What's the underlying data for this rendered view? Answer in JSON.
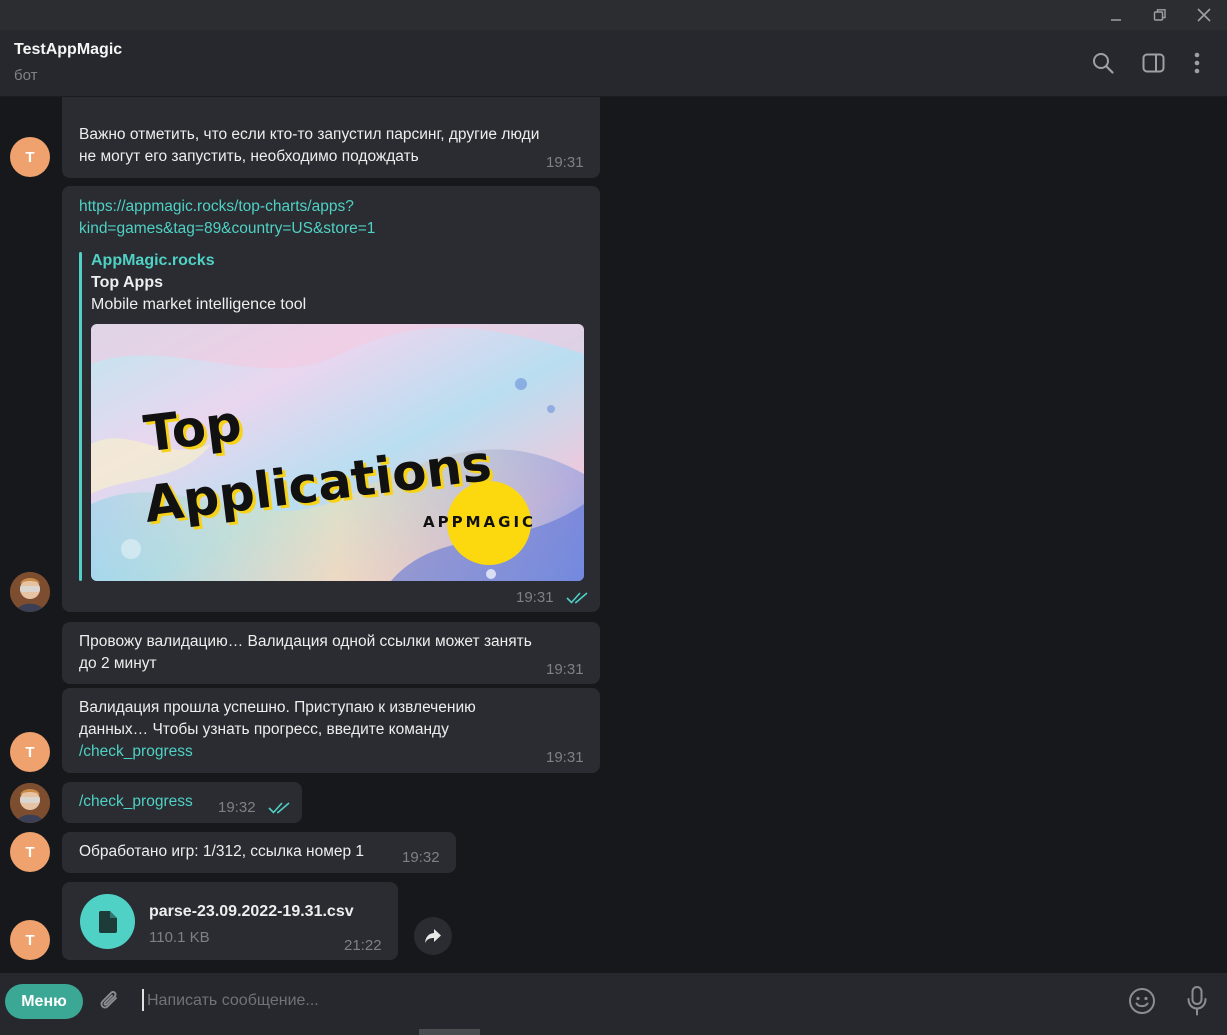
{
  "window": {
    "controls": [
      "minimize-icon",
      "restore-icon",
      "close-icon"
    ]
  },
  "header": {
    "chat_name": "TestAppMagic",
    "chat_status": "бот",
    "icons": [
      "search-icon",
      "sidebar-toggle-icon",
      "more-vertical-icon"
    ]
  },
  "messages": {
    "m1": {
      "line1": "Важно отметить, что если кто-то запустил парсинг, другие люди",
      "line2": "не могут его запустить, необходимо подождать",
      "time": "19:31",
      "avatar_letter": "T"
    },
    "m2": {
      "link_line1": "https://appmagic.rocks/top-charts/apps?",
      "link_line2": "kind=games&tag=89&country=US&store=1",
      "preview_site": "AppMagic.rocks",
      "preview_title": "Top Apps",
      "preview_description": "Mobile market intelligence tool",
      "image_text_line1": "Top",
      "image_text_line2": "Applications",
      "image_logo": "APPMAGIC",
      "time": "19:31"
    },
    "m3": {
      "line1": "Провожу валидацию… Валидация одной ссылки может занять",
      "line2": "до 2 минут",
      "time": "19:31"
    },
    "m4": {
      "line1": "Валидация прошла успешно. Приступаю к извлечению",
      "line2": "данных… Чтобы узнать прогресс, введите команду",
      "command": "/check_progress",
      "time": "19:31",
      "avatar_letter": "T"
    },
    "m5": {
      "command": "/check_progress",
      "time": "19:32"
    },
    "m6": {
      "text": "Обработано игр: 1/312, ссылка номер 1",
      "time": "19:32",
      "avatar_letter": "T"
    },
    "m7": {
      "file_name": "parse-23.09.2022-19.31.csv",
      "file_size": "110.1 KB",
      "time": "21:22",
      "avatar_letter": "T"
    }
  },
  "composer": {
    "menu_label": "Меню",
    "placeholder": "Написать сообщение..."
  },
  "colors": {
    "accent": "#4fd1c5",
    "menu_button": "#3aa895",
    "bubble": "#2a2c31",
    "avatar_bot": "#efa26e",
    "background": "#17181c"
  }
}
